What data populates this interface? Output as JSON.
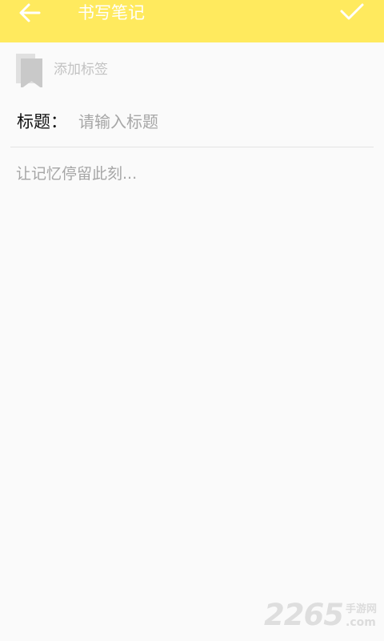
{
  "header": {
    "title": "书写笔记",
    "back_icon": "arrow-left-icon",
    "confirm_icon": "check-icon",
    "background_color": "#ffea5e",
    "text_color": "#ffffff"
  },
  "tag": {
    "icon": "bookmark-icon",
    "label": "添加标签"
  },
  "title_field": {
    "label": "标题：",
    "placeholder": "请输入标题",
    "value": ""
  },
  "content_field": {
    "placeholder": "让记忆停留此刻...",
    "value": ""
  },
  "watermark": {
    "number": "2265",
    "site": "手游网",
    "suffix": ".com"
  }
}
